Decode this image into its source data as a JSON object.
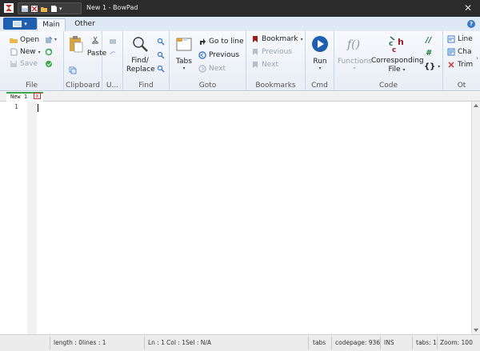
{
  "window": {
    "title": "New 1 - BowPad",
    "close_glyph": "✕"
  },
  "ribbon_tabs": {
    "main": "Main",
    "other": "Other"
  },
  "file_menu": {
    "caret": "▾"
  },
  "help": {
    "glyph": "?"
  },
  "groups": {
    "file": {
      "label": "File",
      "open": "Open",
      "new": "New",
      "save": "Save"
    },
    "clipboard": {
      "label": "Clipboard",
      "paste": "Paste"
    },
    "undo": {
      "label": "U..."
    },
    "find": {
      "label": "Find",
      "find_replace_l1": "Find/",
      "find_replace_l2": "Replace"
    },
    "goto": {
      "label": "Goto",
      "tabs": "Tabs",
      "go_to_line": "Go to line",
      "previous": "Previous",
      "next": "Next"
    },
    "bookmarks": {
      "label": "Bookmarks",
      "bookmark": "Bookmark",
      "previous": "Previous",
      "next": "Next"
    },
    "cmd": {
      "label": "Cmd",
      "run": "Run"
    },
    "code": {
      "label": "Code",
      "functions": "Functions",
      "corresponding_l1": "Corresponding",
      "corresponding_l2": "File",
      "comment": "//",
      "hash": "#",
      "braces": "{}"
    },
    "other": {
      "label": "Ot",
      "line": "Line",
      "cha": "Cha",
      "trim": "Trim"
    }
  },
  "document": {
    "tab_label": "New 1",
    "close_glyph": "x",
    "line_number": "1"
  },
  "status": {
    "length": "length : 0",
    "lines": "lines : 1",
    "ln": "Ln : 1",
    "col": "Col : 1",
    "sel": "Sel : N/A",
    "tabs": "tabs",
    "codepage": "codepage: 936",
    "ins": "INS",
    "tabs_count": "tabs: 1",
    "zoom": "Zoom: 100"
  },
  "colors": {
    "accent": "#1f5fb0",
    "ribbon_tab_bg": "#dfe9f5",
    "doc_tab_indicator": "#3aa64a"
  }
}
